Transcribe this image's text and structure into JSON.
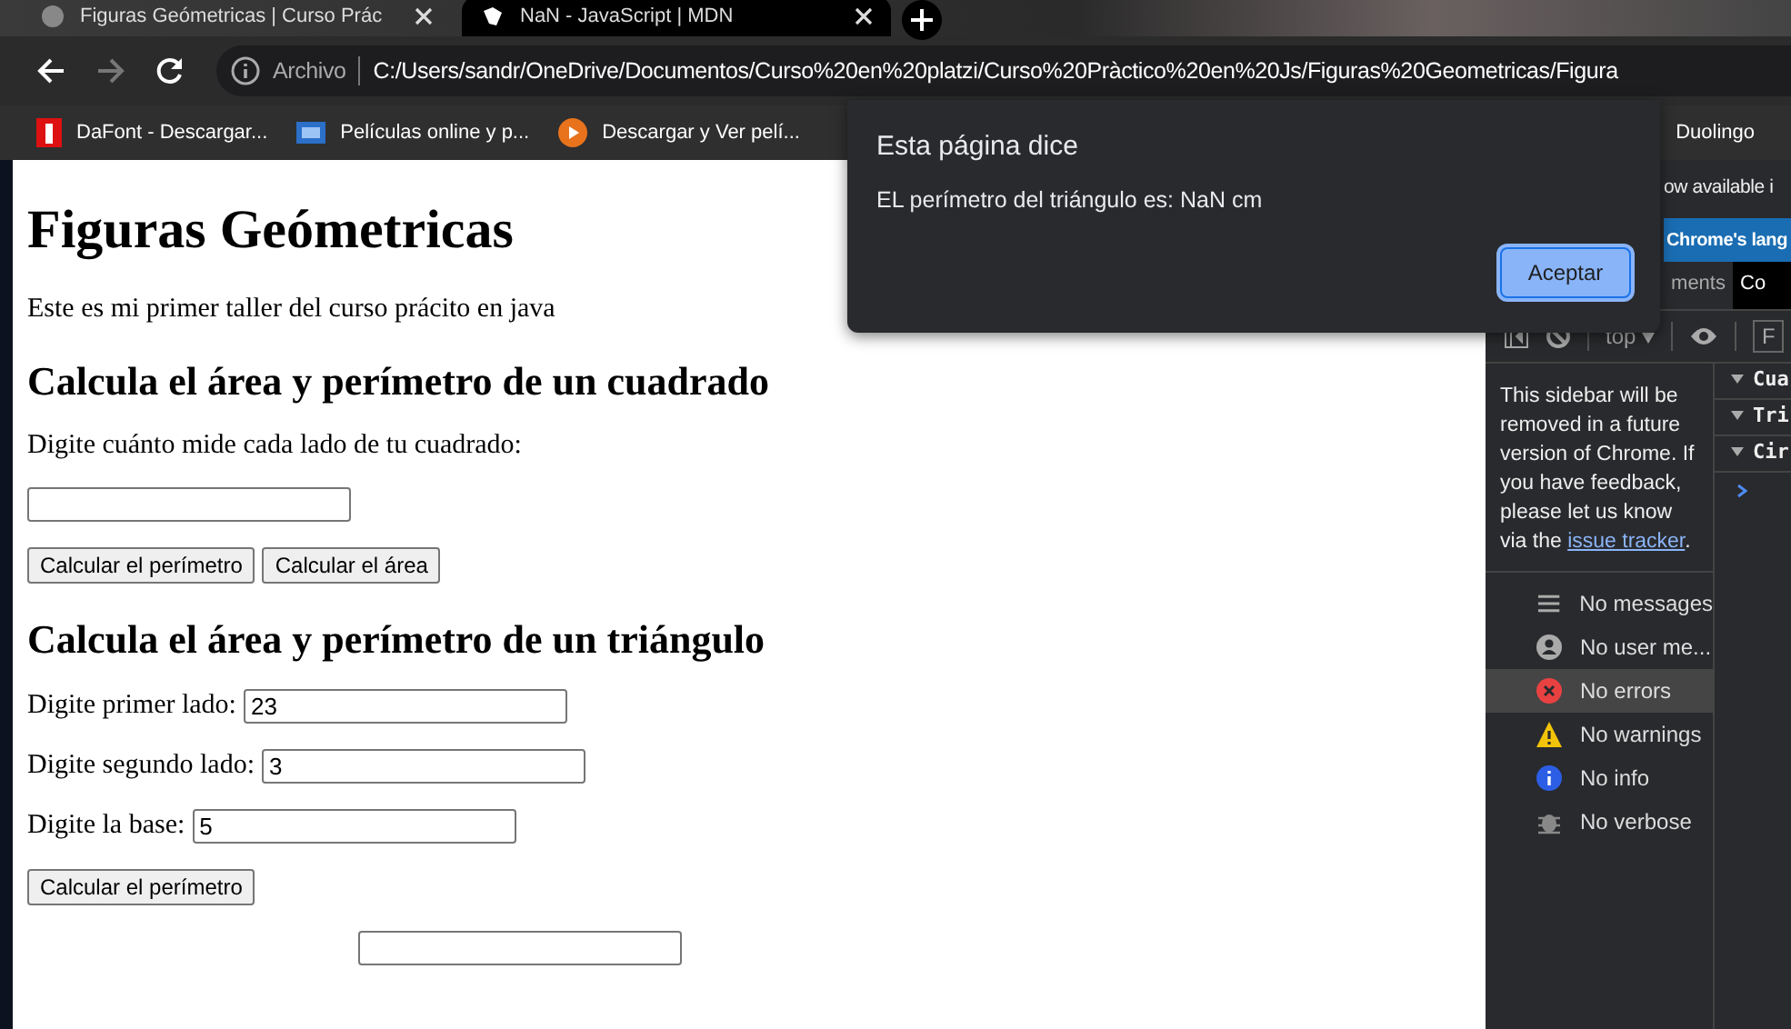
{
  "browser": {
    "tabs": [
      {
        "title": "Figuras Geómetricas | Curso Prác",
        "selected": false
      },
      {
        "title": "NaN - JavaScript | MDN",
        "selected": true
      }
    ],
    "navigation": {
      "back_disabled": false,
      "forward_disabled": true
    },
    "address": {
      "scheme_label": "Archivo",
      "url": "C:/Users/sandr/OneDrive/Documentos/Curso%20en%20platzi/Curso%20Pràctico%20en%20Js/Figuras%20Geometricas/Figura"
    },
    "bookmarks": [
      {
        "label": "DaFont - Descargar...",
        "kind": "dafont"
      },
      {
        "label": "Películas online y p...",
        "kind": "all"
      },
      {
        "label": "Descargar y Ver pelí...",
        "kind": "play"
      },
      {
        "label": "Duolingo",
        "kind": "none"
      }
    ]
  },
  "page": {
    "title": "Figuras Geómetricas",
    "intro": "Este es mi primer taller del curso prácito en java",
    "sections": [
      {
        "heading": "Calcula el área y perímetro de un cuadrado",
        "fields": [
          {
            "kind": "block",
            "label": "Digite cuánto mide cada lado de tu cuadrado:"
          }
        ],
        "buttons": [
          "Calcular el perímetro",
          "Calcular el área"
        ]
      },
      {
        "heading": "Calcula el área y perímetro de un triángulo",
        "fields": [
          {
            "kind": "inline",
            "label": "Digite primer lado:",
            "value": "23"
          },
          {
            "kind": "inline",
            "label": "Digite segundo lado:",
            "value": "3"
          },
          {
            "kind": "inline",
            "label": "Digite la base:",
            "value": "5"
          }
        ],
        "buttons": [
          "Calcular el perímetro"
        ]
      },
      {
        "fields": [
          {
            "kind": "cut"
          }
        ]
      }
    ]
  },
  "dialog": {
    "title": "Esta página dice",
    "message": "EL perímetro del triángulo es: NaN cm",
    "buttons": [
      "Aceptar"
    ]
  },
  "devtools": {
    "banner": "ow available i",
    "language_button": "Chrome's lang",
    "tabs": [
      {
        "label": "ments",
        "selected": false
      },
      {
        "label": "Co",
        "selected": true
      }
    ],
    "context": "top",
    "filter": "F",
    "sidebar_note": "This sidebar will be removed in a future version of Chrome. If you have feedback, please let us know via the",
    "sidebar_link": "issue tracker",
    "sidebar_note_end": ".",
    "filters": [
      {
        "label": "No messages",
        "kind": "list",
        "selected": false
      },
      {
        "label": "No user me...",
        "kind": "user",
        "selected": false
      },
      {
        "label": "No errors",
        "kind": "error",
        "selected": true
      },
      {
        "label": "No warnings",
        "kind": "warning",
        "selected": false
      },
      {
        "label": "No info",
        "kind": "info",
        "selected": false
      },
      {
        "label": "No verbose",
        "kind": "verbose",
        "selected": false
      }
    ],
    "groups": [
      {
        "label": "Cua",
        "expanded": true
      },
      {
        "label": "Tri",
        "expanded": true
      },
      {
        "label": "Cir",
        "expanded": true
      }
    ]
  }
}
